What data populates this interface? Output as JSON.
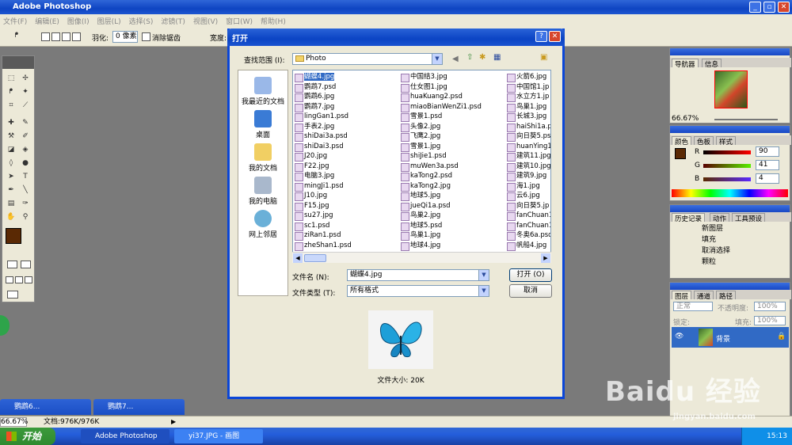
{
  "app": {
    "title": "Adobe Photoshop"
  },
  "menu": [
    "文件(F)",
    "编辑(E)",
    "图像(I)",
    "图层(L)",
    "选择(S)",
    "滤镜(T)",
    "视图(V)",
    "窗口(W)",
    "帮助(H)"
  ],
  "options": {
    "feather_label": "羽化:",
    "feather_value": "0 像素",
    "antialias_label": "消除锯齿",
    "width_label": "宽度:"
  },
  "dialog": {
    "title": "打开",
    "look_in_label": "查找范围 (I):",
    "look_in_value": "Photo",
    "places": [
      "我最近的文档",
      "桌面",
      "我的文档",
      "我的电脑",
      "网上邻居"
    ],
    "files_col1": [
      "蝴蝶4.jpg",
      "鹦鹉7.psd",
      "鹦鹉6.jpg",
      "鹦鹉7.jpg",
      "lingGan1.psd",
      "手表2.jpg",
      "shiDai3a.psd",
      "shiDai3.psd",
      "J20.jpg",
      "F22.jpg",
      "电脑3.jpg",
      "mingJi1.psd",
      "J10.jpg",
      "F15.jpg",
      "su27.jpg",
      "sc1.psd",
      "ziRan1.psd",
      "zheShan1.psd"
    ],
    "files_col2": [
      "中国结3.jpg",
      "仕女图1.jpg",
      "huaKuang2.psd",
      "miaoBianWenZi1.psd",
      "雪景1.psd",
      "头像2.jpg",
      "飞鹰2.jpg",
      "雪景1.jpg",
      "shiJie1.psd",
      "muWen3a.psd",
      "kaTong2.psd",
      "kaTong2.jpg",
      "地球5.jpg",
      "jueQi1a.psd",
      "鸟巢2.jpg",
      "地球5.psd",
      "鸟巢1.jpg",
      "地球4.jpg"
    ],
    "files_col3": [
      "火箭6.jpg",
      "中国馆1.jp",
      "水立方1.jp",
      "鸟巢1.jpg",
      "长城3.jpg",
      "haiShi1a.p",
      "向日葵5.ps",
      "huanYing1a",
      "建筑11.jpg",
      "建筑10.jpg",
      "建筑9.jpg",
      "海1.jpg",
      "云6.jpg",
      "向日葵5.jp",
      "fanChuan1b",
      "fanChuan1a",
      "冬奥6a.psd",
      "帆船4.jpg"
    ],
    "filename_label": "文件名 (N):",
    "filename_value": "蝴蝶4.jpg",
    "filetype_label": "文件类型 (T):",
    "filetype_value": "所有格式",
    "open_button": "打开 (O)",
    "cancel_button": "取消",
    "filesize_label": "文件大小: 20K"
  },
  "panels": {
    "navigator": {
      "tabs": [
        "导航器",
        "信息"
      ],
      "zoom": "66.67%"
    },
    "color": {
      "tabs": [
        "颜色",
        "色板",
        "样式"
      ],
      "r": "90",
      "g": "41",
      "b": "4",
      "r_label": "R",
      "g_label": "G",
      "b_label": "B"
    },
    "history": {
      "tabs": [
        "历史记录",
        "动作",
        "工具预设"
      ],
      "items": [
        "新图层",
        "填充",
        "取消选择",
        "颗粒"
      ]
    },
    "layers": {
      "tabs": [
        "图层",
        "通道",
        "路径"
      ],
      "mode": "正常",
      "opacity_label": "不透明度:",
      "opacity": "100%",
      "lock_label": "锁定:",
      "fill_label": "填充:",
      "fill": "100%",
      "layer_name": "背景"
    }
  },
  "minidocs": [
    "鹦鹉6...",
    "鹦鹉7..."
  ],
  "status": {
    "zoom": "66.67%",
    "doc": "文档:976K/976K"
  },
  "taskbar": {
    "start": "开始",
    "items": [
      "Adobe Photoshop",
      "yi37.JPG - 画图"
    ],
    "clock": "15:13"
  },
  "watermark": {
    "brand": "Baidu 经验",
    "url": "jingyan.baidu.com"
  },
  "colors": {
    "title_blue": "#0a46d8",
    "foreground": "#5a2904",
    "selection": "#316ac5"
  }
}
